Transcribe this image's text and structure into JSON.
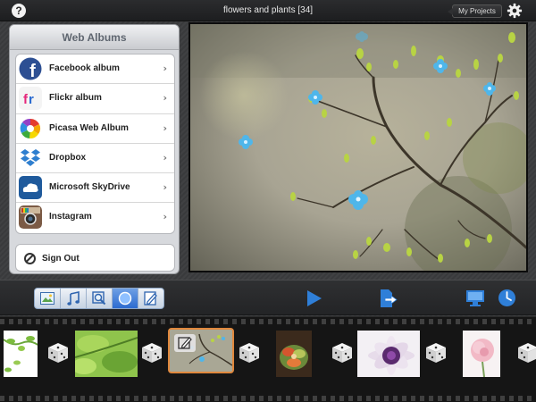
{
  "topbar": {
    "help_label": "?",
    "title": "flowers and plants  [34]",
    "my_projects_label": "My Projects"
  },
  "albums": {
    "header": "Web Albums",
    "items": [
      {
        "label": "Facebook album",
        "icon": "facebook-icon"
      },
      {
        "label": "Flickr album",
        "icon": "flickr-icon"
      },
      {
        "label": "Picasa Web Album",
        "icon": "picasa-icon"
      },
      {
        "label": "Dropbox",
        "icon": "dropbox-icon"
      },
      {
        "label": "Microsoft SkyDrive",
        "icon": "skydrive-icon"
      },
      {
        "label": "Instagram",
        "icon": "instagram-icon"
      }
    ],
    "chevron": "›",
    "sign_out_label": "Sign Out"
  },
  "toolbar": {
    "segments": [
      "photo-icon",
      "music-icon",
      "zoom-icon",
      "circle-icon",
      "edit-icon"
    ],
    "active_segment": "circle-icon",
    "accent_color": "#2f7fd8"
  },
  "filmstrip": {
    "items": [
      "thumbnail",
      "dice-icon",
      "thumbnail",
      "dice-icon",
      "thumbnail-selected",
      "dice-icon",
      "thumbnail",
      "dice-icon",
      "thumbnail",
      "dice-icon",
      "thumbnail",
      "dice-icon"
    ],
    "selected_color": "#e0883d"
  }
}
